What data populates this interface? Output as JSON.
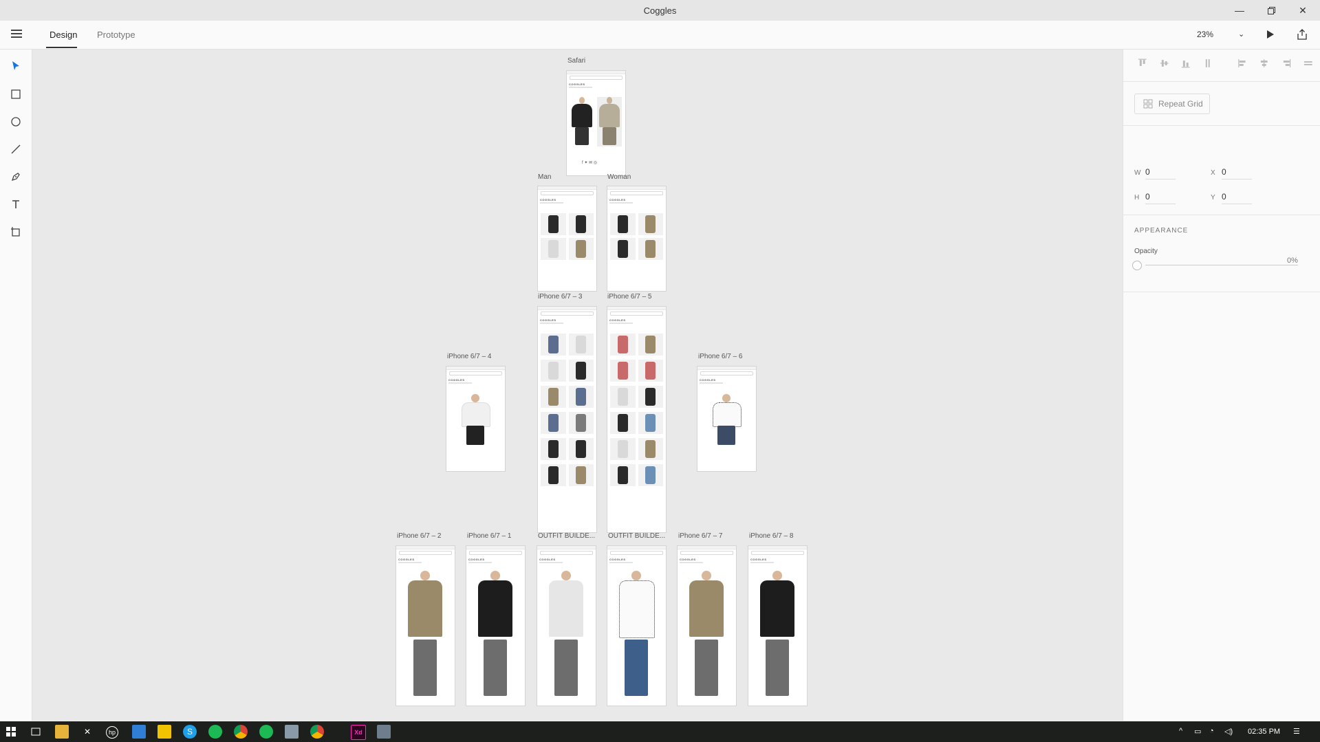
{
  "window": {
    "title": "Coggles",
    "controls": [
      "minimize-icon",
      "restore-icon",
      "close-icon"
    ]
  },
  "header": {
    "tabs": [
      {
        "label": "Design",
        "active": true
      },
      {
        "label": "Prototype",
        "active": false
      }
    ],
    "zoom": "23%",
    "icons": [
      "menu-icon",
      "play-icon",
      "share-icon"
    ]
  },
  "toolbar": {
    "tools": [
      "select-icon",
      "rectangle-icon",
      "ellipse-icon",
      "line-icon",
      "pen-icon",
      "text-icon",
      "artboard-icon"
    ]
  },
  "canvas": {
    "artboards": [
      {
        "label": "Safari"
      },
      {
        "label": "Man"
      },
      {
        "label": "Woman"
      },
      {
        "label": "iPhone 6/7 – 3"
      },
      {
        "label": "iPhone 6/7 – 5"
      },
      {
        "label": "iPhone 6/7 – 4"
      },
      {
        "label": "iPhone 6/7 – 6"
      },
      {
        "label": "iPhone 6/7 – 2"
      },
      {
        "label": "iPhone 6/7 – 1"
      },
      {
        "label": "OUTFIT BUILDE..."
      },
      {
        "label": "OUTFIT BUILDE..."
      },
      {
        "label": "iPhone 6/7 – 7"
      },
      {
        "label": "iPhone 6/7 – 8"
      }
    ],
    "brand": "COGGLES"
  },
  "properties": {
    "repeat_grid": "Repeat Grid",
    "w_label": "W",
    "w_value": "0",
    "x_label": "X",
    "x_value": "0",
    "h_label": "H",
    "h_value": "0",
    "y_label": "Y",
    "y_value": "0",
    "appearance": "APPEARANCE",
    "opacity_label": "Opacity",
    "opacity_value": "0%"
  },
  "taskbar": {
    "time": "02:35 PM",
    "apps": [
      "windows-start-icon",
      "task-view-icon",
      "file-explorer-icon",
      "xbox-icon",
      "hp-icon",
      "app-blue-icon",
      "app-yellow-icon",
      "skype-icon",
      "spotify-icon",
      "chrome-icon",
      "spotify-icon",
      "app-grey-icon",
      "chrome-icon",
      "adobe-xd-icon",
      "app-misc-icon"
    ]
  },
  "colors": {
    "accent": "#1473e6",
    "xd_brand": "#ff26be",
    "canvas_bg": "#e9e9e9"
  }
}
